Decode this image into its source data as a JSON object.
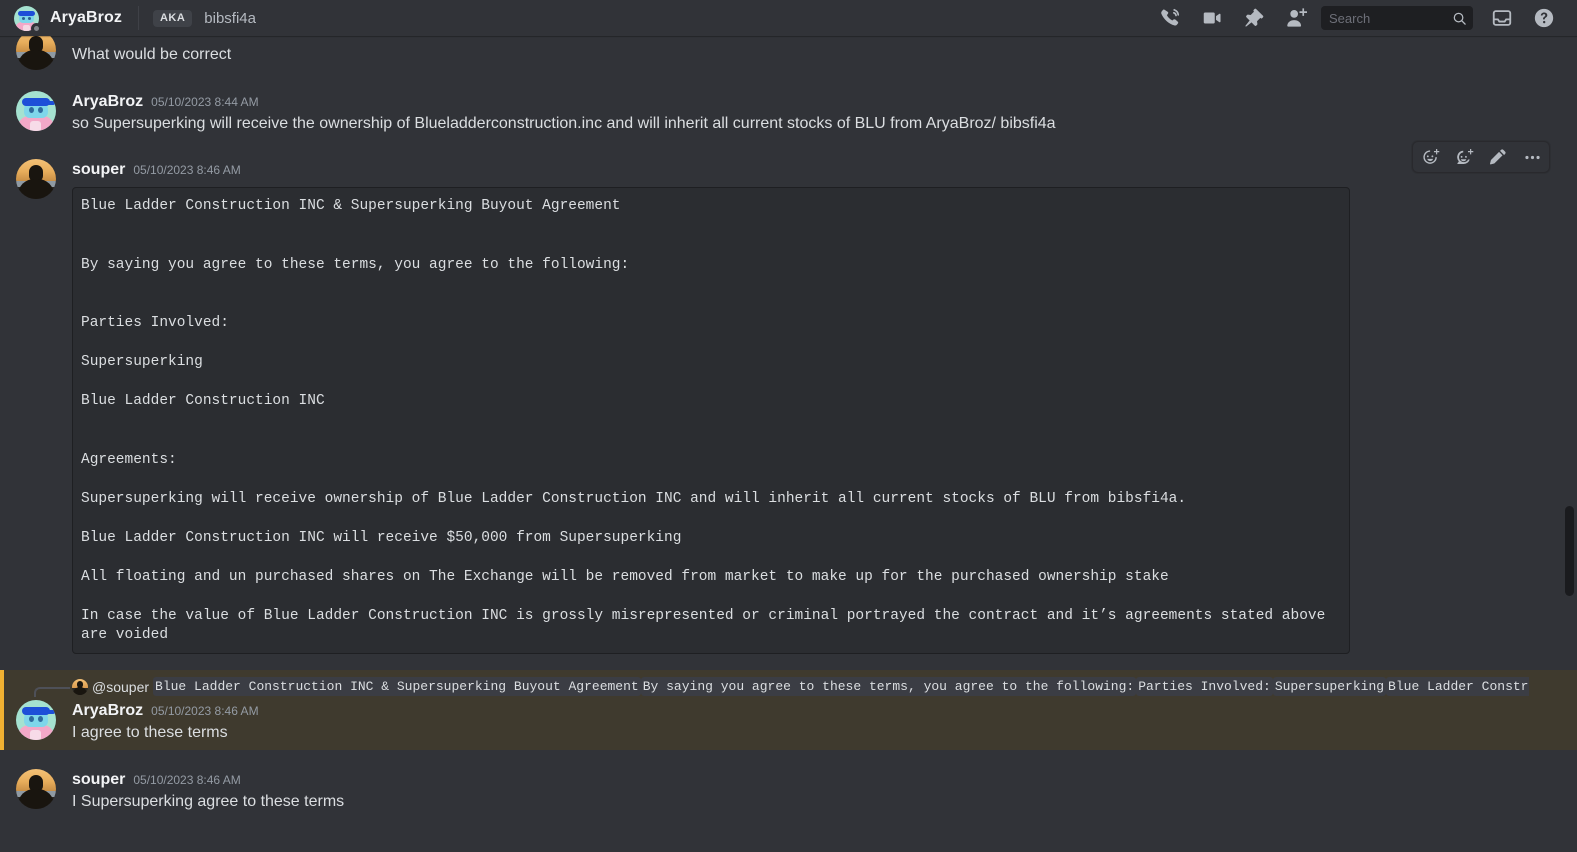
{
  "topbar": {
    "dm_name": "AryaBroz",
    "aka_badge": "AKA",
    "aka_name": "bibsfi4a",
    "icons": [
      "call-icon",
      "video-call-icon",
      "pinned-messages-icon",
      "add-friend-icon",
      "inbox-icon",
      "help-icon"
    ],
    "search": {
      "placeholder": "Search"
    }
  },
  "action_bar": {
    "items": [
      "add-reaction-icon",
      "add-super-reaction-icon",
      "edit-icon",
      "more-icon"
    ]
  },
  "messages": [
    {
      "author": "",
      "timestamp": "",
      "text": "What would be correct"
    },
    {
      "author": "AryaBroz",
      "timestamp": "05/10/2023 8:44 AM",
      "text": "so Supersuperking will receive the ownership of Blueladderconstruction.inc and will inherit all current stocks of BLU from AryaBroz/ bibsfi4a"
    },
    {
      "author": "souper",
      "timestamp": "05/10/2023 8:46 AM",
      "code": "Blue Ladder Construction INC & Supersuperking Buyout Agreement\n\n\nBy saying you agree to these terms, you agree to the following:\n\n\nParties Involved:\n\nSupersuperking\n\nBlue Ladder Construction INC\n\n\nAgreements:\n\nSupersuperking will receive ownership of Blue Ladder Construction INC and will inherit all current stocks of BLU from bibsfi4a.\n\nBlue Ladder Construction INC will receive $50,000 from Supersuperking\n\nAll floating and un purchased shares on The Exchange will be removed from market to make up for the purchased ownership stake\n\nIn case the value of Blue Ladder Construction INC is grossly misrepresented or criminal portrayed the contract and it’s agreements stated above are voided"
    },
    {
      "author": "AryaBroz",
      "timestamp": "05/10/2023 8:46 AM",
      "text": "I agree to these terms",
      "reply": {
        "user": "@souper",
        "snippets": [
          "Blue Ladder Construction INC & Supersuperking Buyout Agreement",
          "By saying you agree to these terms, you agree to the following:",
          "Parties Involved:",
          "Supersuperking",
          "Blue Ladder Construc"
        ]
      }
    },
    {
      "author": "souper",
      "timestamp": "05/10/2023 8:46 AM",
      "text": "I Supersuperking agree to these terms"
    }
  ],
  "colors": {
    "app_background": "#313338",
    "code_background": "#2b2d31",
    "mention_background": "#3f3a2e",
    "mention_accent": "#f0b132",
    "text_primary": "#dbdee1",
    "text_muted": "#949ba4"
  }
}
